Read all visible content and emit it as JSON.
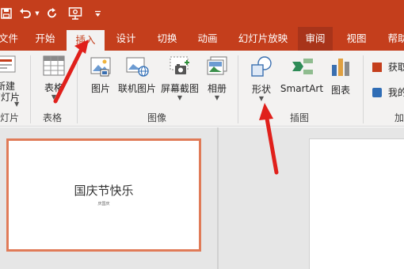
{
  "colors": {
    "brand": "#c43e1c",
    "ribbon_bg": "#f3f2f1",
    "workspace_bg": "#e6e6e6",
    "thumb_border": "#e07b58",
    "arrow": "#e0201b"
  },
  "quick_access": {
    "icons": [
      "save-icon",
      "undo-icon",
      "dropdown-arrow-icon",
      "redo-icon",
      "present-from-start-icon",
      "customize-qat-icon"
    ]
  },
  "tabs": [
    {
      "label": "文件"
    },
    {
      "label": "开始"
    },
    {
      "label": "插入"
    },
    {
      "label": "设计"
    },
    {
      "label": "切换"
    },
    {
      "label": "动画"
    },
    {
      "label": "幻灯片放映"
    },
    {
      "label": "审阅"
    },
    {
      "label": "视图"
    },
    {
      "label": "帮助"
    }
  ],
  "ribbon": {
    "groups": {
      "slides": {
        "label": "幻灯片",
        "new_slide_line1": "新建",
        "new_slide_line2": "幻灯片"
      },
      "tables": {
        "label": "表格",
        "table": "表格"
      },
      "images": {
        "label": "图像",
        "picture": "图片",
        "online_picture": "联机图片",
        "screenshot": "屏幕截图",
        "album": "相册"
      },
      "illustrations": {
        "label": "插图",
        "shapes": "形状",
        "smartart": "SmartArt",
        "chart": "图表"
      },
      "addins": {
        "label": "加",
        "get_addins": "获取",
        "my_addins": "我的"
      }
    }
  },
  "slide": {
    "title": "国庆节快乐",
    "subtitle": "庆国庆"
  }
}
